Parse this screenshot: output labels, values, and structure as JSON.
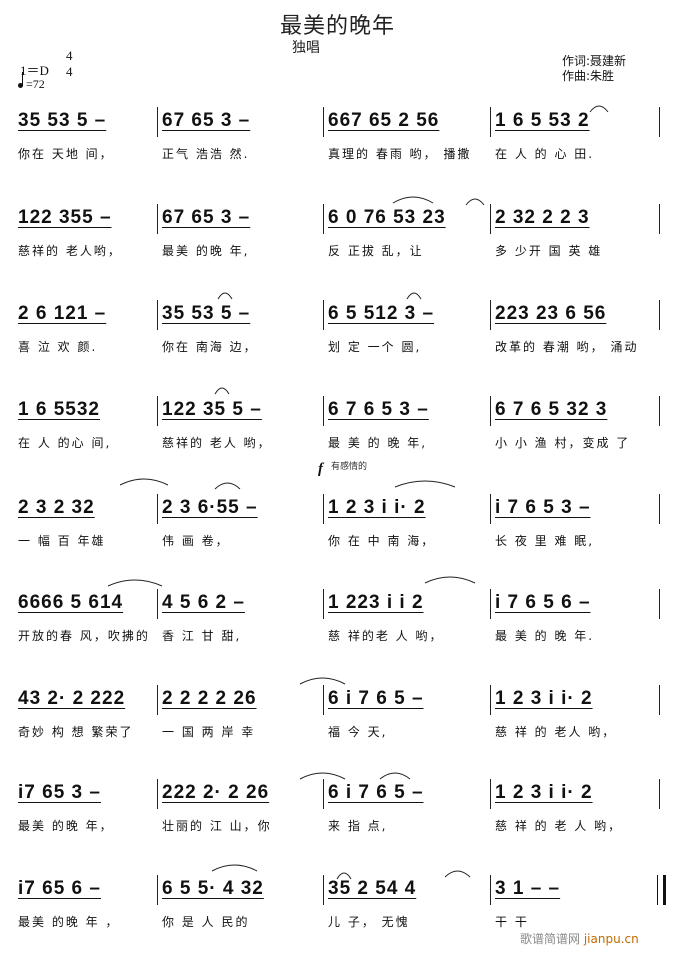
{
  "header": {
    "title": "最美的晚年",
    "subtitle": "独唱",
    "key": "1＝D",
    "time_top": "4",
    "time_bottom": "4",
    "tempo": "=72",
    "lyricist": "作词:聂建新",
    "composer": "作曲:朱胜"
  },
  "expression": {
    "dynamic": "f",
    "text": "有感情的"
  },
  "rows": [
    {
      "bars": [
        {
          "notes": "35  53  5  –",
          "lyrics": "你在  天地  间，"
        },
        {
          "notes": "67  65  3  –",
          "lyrics": "正气  浩浩  然."
        },
        {
          "notes": "667  65  2   56",
          "lyrics": "真理的  春雨  哟，  播撒"
        },
        {
          "notes": "1  6   5  53  2",
          "lyrics": "在  人   的  心   田."
        }
      ]
    },
    {
      "bars": [
        {
          "notes": "122  355  –",
          "lyrics": "慈祥的  老人哟，"
        },
        {
          "notes": "67  65  3  –",
          "lyrics": "最美  的晚  年,"
        },
        {
          "notes": "6 0  76  53  23",
          "lyrics": "反     正拔   乱，让"
        },
        {
          "notes": "2   32  2  2   3",
          "lyrics": "多   少开  国  英   雄"
        }
      ]
    },
    {
      "bars": [
        {
          "notes": "2 6  121  –",
          "lyrics": "喜 泣  欢  颜."
        },
        {
          "notes": "35  53  5  –",
          "lyrics": "你在  南海  边，"
        },
        {
          "notes": "6 5  512  3  –",
          "lyrics": "划  定  一个    圆,"
        },
        {
          "notes": "223  23  6   56",
          "lyrics": "改革的  春潮  哟，  涌动"
        }
      ]
    },
    {
      "bars": [
        {
          "notes": "1  6   5532",
          "lyrics": "在  人   的心  间,"
        },
        {
          "notes": "122  35  5  –",
          "lyrics": "慈祥的  老人  哟，"
        },
        {
          "notes": "6 7 6 5  3  –",
          "lyrics": "最 美  的 晚  年,"
        },
        {
          "notes": "6 7 6 5  32   3",
          "lyrics": "小 小 渔 村，变成   了"
        }
      ]
    },
    {
      "bars": [
        {
          "notes": "2   3  2  32",
          "lyrics": "一    幅  百  年雄"
        },
        {
          "notes": "2  3  6·55  –",
          "lyrics": "     伟  画   卷，"
        },
        {
          "notes": "1 2  3 i  i·   2",
          "lyrics": "你 在  中  南  海，"
        },
        {
          "notes": "i  7  6 5  3  –",
          "lyrics": "长  夜 里 难  眠,"
        }
      ]
    },
    {
      "bars": [
        {
          "notes": "6666  5  614",
          "lyrics": "开放的春 风，吹拂的"
        },
        {
          "notes": "4   5  6  2  –",
          "lyrics": "香    江  甘  甜,"
        },
        {
          "notes": "1  223  i   i    2",
          "lyrics": "慈  祥的老  人  哟，"
        },
        {
          "notes": "i  7  6  5  6  –",
          "lyrics": "最  美  的  晚  年."
        }
      ]
    },
    {
      "bars": [
        {
          "notes": "43  2·  2  222",
          "lyrics": "奇妙  构   想  繁荣了"
        },
        {
          "notes": "2   2  2   2  26",
          "lyrics": "一   国  两   岸  幸"
        },
        {
          "notes": "6  i  7  6  5  –",
          "lyrics": "    福  今     天,"
        },
        {
          "notes": "1  2  3  i  i·   2",
          "lyrics": "慈  祥  的  老人    哟，"
        }
      ]
    },
    {
      "bars": [
        {
          "notes": "i7  65  3  –",
          "lyrics": "最美  的晚  年，"
        },
        {
          "notes": "222  2·   2  26",
          "lyrics": "壮丽的  江    山，你"
        },
        {
          "notes": "6  i  7  6  5  –",
          "lyrics": "   来  指     点,"
        },
        {
          "notes": "1  2  3  i  i·   2",
          "lyrics": "慈  祥  的  老  人    哟，"
        }
      ]
    },
    {
      "bars": [
        {
          "notes": "i7  65  6  –",
          "lyrics": "最美  的晚  年  ，"
        },
        {
          "notes": "6  5  5·   4  32",
          "lyrics": "你  是  人      民的"
        },
        {
          "notes": "35  2   54  4",
          "lyrics": "儿  子，  无愧"
        },
        {
          "notes": "3   1  –  –",
          "lyrics": "干   干"
        }
      ]
    }
  ],
  "watermark": {
    "site": "歌谱简谱网",
    "url": "jianpu.cn"
  }
}
